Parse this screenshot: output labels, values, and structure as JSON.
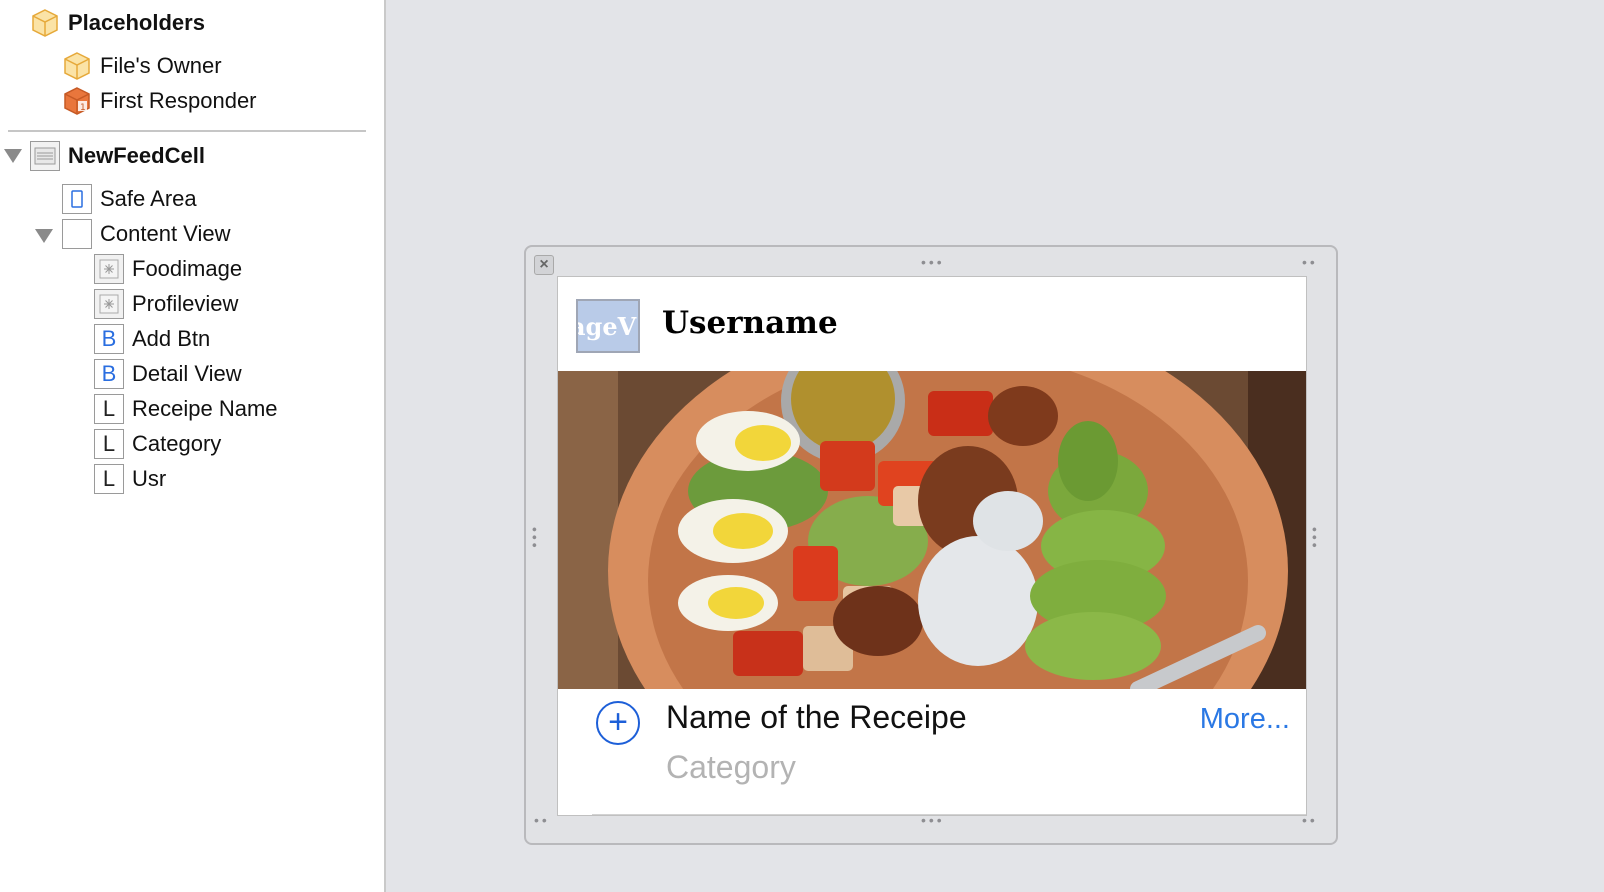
{
  "outline": {
    "placeholders": {
      "label": "Placeholders",
      "files_owner": "File's Owner",
      "first_responder": "First Responder"
    },
    "cell": {
      "label": "NewFeedCell",
      "safe_area": "Safe Area",
      "content_view": "Content View",
      "children": [
        {
          "label": "Foodimage",
          "icon": "image-view-icon"
        },
        {
          "label": "Profileview",
          "icon": "image-view-icon"
        },
        {
          "label": "Add Btn",
          "badge": "B"
        },
        {
          "label": "Detail View",
          "badge": "B"
        },
        {
          "label": "Receipe Name",
          "badge": "L"
        },
        {
          "label": "Category",
          "badge": "L"
        },
        {
          "label": "Usr",
          "badge": "L"
        }
      ]
    }
  },
  "cell_preview": {
    "profile_view_text": "ageV",
    "username": "Username",
    "add_button_glyph": "+",
    "recipe_name": "Name of the Receipe",
    "category": "Category",
    "detail_button": "More...",
    "close_glyph": "×"
  },
  "colors": {
    "accent_blue": "#2a78e4",
    "placeholder_orange": "#e27a3f",
    "canvas_bg": "#e3e4e8"
  }
}
